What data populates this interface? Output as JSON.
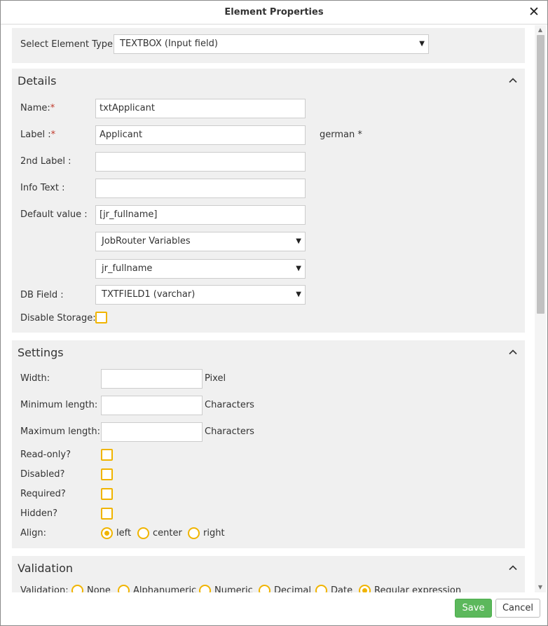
{
  "dialog": {
    "title": "Element Properties",
    "close_glyph": "✕",
    "icon_close": "close-icon"
  },
  "element_type": {
    "label": "Select Element Type:",
    "value": "TEXTBOX (Input field)"
  },
  "details": {
    "title": "Details",
    "name_label": "Name:",
    "name_value": "txtApplicant",
    "label_label": "Label :",
    "label_value": "Applicant",
    "language_note": "german *",
    "second_label_label": "2nd Label :",
    "second_label_value": "",
    "info_text_label": "Info Text :",
    "info_text_value": "",
    "default_value_label": "Default value :",
    "default_value_value": "[jr_fullname]",
    "variable_source_value": "JobRouter Variables",
    "variable_value": "jr_fullname",
    "db_field_label": "DB Field :",
    "db_field_value": "TXTFIELD1 (varchar)",
    "disable_storage_label": "Disable Storage:",
    "required_marker": "*"
  },
  "settings": {
    "title": "Settings",
    "width_label": "Width:",
    "width_value": "",
    "width_unit": "Pixel",
    "min_length_label": "Minimum length:",
    "min_length_value": "",
    "min_length_unit": "Characters",
    "max_length_label": "Maximum length:",
    "max_length_value": "",
    "max_length_unit": "Characters",
    "readonly_label": "Read-only?",
    "disabled_label": "Disabled?",
    "required_label": "Required?",
    "hidden_label": "Hidden?",
    "align_label": "Align:",
    "align_options": [
      "left",
      "center",
      "right"
    ],
    "align_selected": "left"
  },
  "validation": {
    "title": "Validation",
    "label": "Validation:",
    "options": [
      "None",
      "Alphanumeric",
      "Numeric",
      "Decimal",
      "Date",
      "Regular expression"
    ],
    "selected": "Regular expression"
  },
  "footer": {
    "save_label": "Save",
    "cancel_label": "Cancel"
  },
  "colors": {
    "accent": "#f0b400",
    "save_green": "#5cb85c",
    "panel_bg": "#f0f0f0",
    "required_red": "#c0392b"
  }
}
